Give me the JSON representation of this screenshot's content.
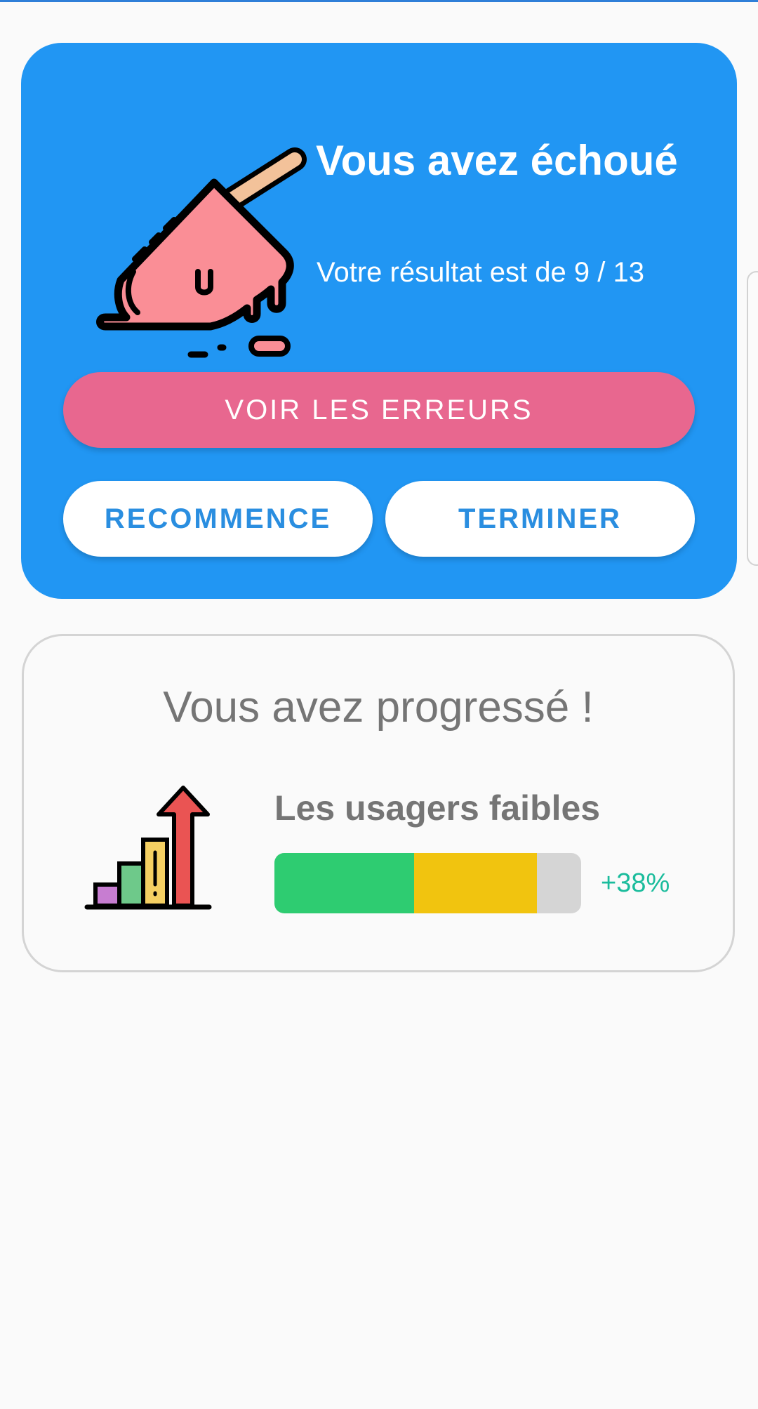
{
  "result": {
    "title": "Vous avez échoué",
    "score_text": "Votre résultat est de 9 / 13",
    "score": 9,
    "total": 13,
    "illustration": "melted-popsicle-icon",
    "view_errors_label": "VOIR LES ERREURS",
    "restart_label": "RECOMMENCE",
    "finish_label": "TERMINER"
  },
  "progress": {
    "title": "Vous avez progressé !",
    "icon": "growth-chart-icon",
    "skill_name": "Les usagers faibles",
    "previous_fraction": 0.455,
    "gain_fraction": 0.4,
    "gain_label": "+38%"
  },
  "colors": {
    "card_blue": "#2196f3",
    "errors_button": "#e8678f",
    "button_text": "#2a8ee0",
    "bar_previous": "#2ecc71",
    "bar_gain": "#f1c40f",
    "bar_track": "#d5d5d5",
    "gain_text": "#1abc9c"
  }
}
